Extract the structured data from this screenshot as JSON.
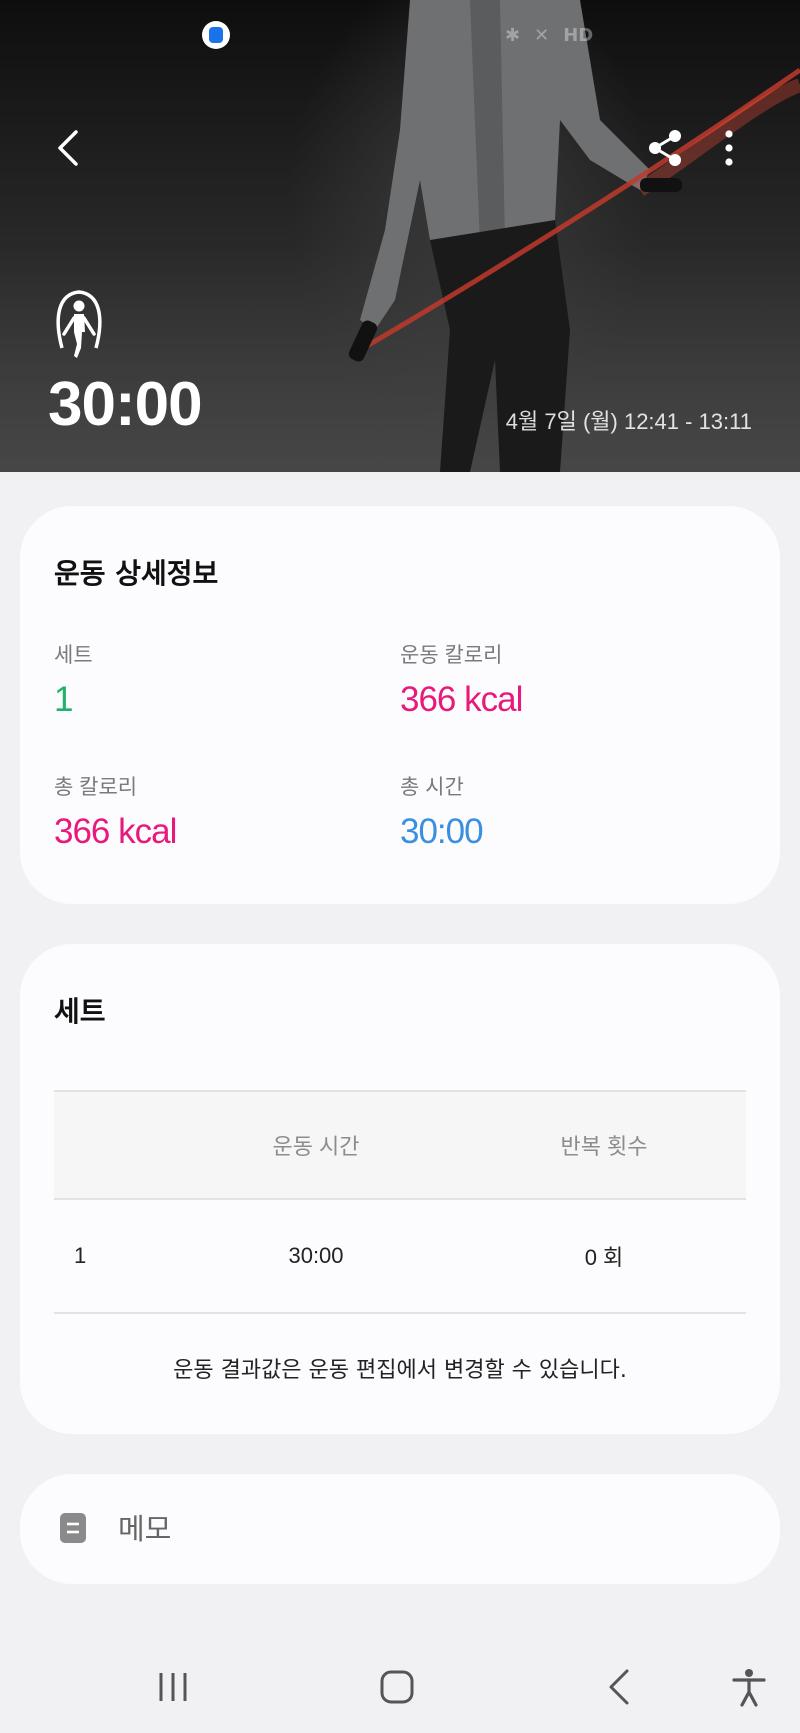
{
  "hero": {
    "duration": "30:00",
    "datetime": "4월 7일 (월) 12:41 - 13:11",
    "status_icons": [
      "bluetooth-icon",
      "mute-icon",
      "hd-voice-icon"
    ],
    "hd_label": "HD"
  },
  "toolbar": {
    "back_icon": "chevron-left-icon",
    "share_icon": "share-icon",
    "more_icon": "more-vertical-icon"
  },
  "details": {
    "title": "운동 상세정보",
    "stats": [
      {
        "label": "세트",
        "value": "1",
        "color": "#1db36b"
      },
      {
        "label": "운동 칼로리",
        "value": "366 kcal",
        "color": "#e8197d"
      },
      {
        "label": "총 칼로리",
        "value": "366 kcal",
        "color": "#e8197d"
      },
      {
        "label": "총 시간",
        "value": "30:00",
        "color": "#3a8fe0"
      }
    ]
  },
  "sets": {
    "title": "세트",
    "columns": [
      "",
      "운동 시간",
      "반복 횟수"
    ],
    "rows": [
      {
        "index": "1",
        "time": "30:00",
        "reps": "0 회"
      }
    ],
    "note": "운동 결과값은 운동 편집에서 변경할 수 있습니다."
  },
  "memo": {
    "label": "메모",
    "icon": "memo-icon"
  },
  "navbar": {
    "items": [
      "recent-apps-icon",
      "home-icon",
      "back-icon",
      "accessibility-icon"
    ]
  }
}
